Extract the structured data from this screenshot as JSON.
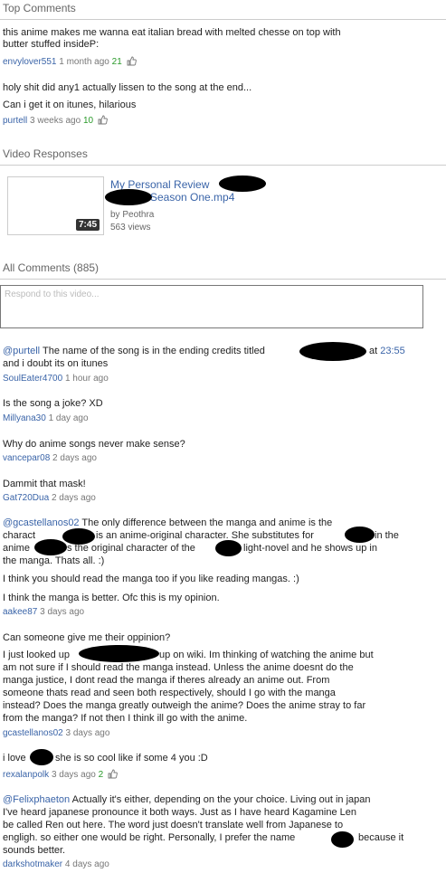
{
  "sections": {
    "top_comments": "Top Comments",
    "video_responses": "Video Responses",
    "all_comments": "All Comments (885)"
  },
  "top_comments": [
    {
      "line1": "this anime makes me wanna eat italian bread with melted chesse on top with",
      "line2": "butter stuffed insideP:",
      "user": "envylover551",
      "time": "1 month ago",
      "likes": "21"
    },
    {
      "line1": "holy shit did any1 actually lissen to the song at the end...",
      "line2": "Can i get it on itunes, hilarious",
      "user": "purtell",
      "time": "3 weeks ago",
      "likes": "10"
    }
  ],
  "video_response": {
    "title_1": "My Personal Review",
    "title_2": "Season One.mp4",
    "by": "by Peothra",
    "views": "563 views",
    "duration": "7:45"
  },
  "respond_placeholder": "Respond to this video...",
  "comments": [
    {
      "mention": "@purtell",
      "t1": "The name of the song is in the ending credits titled",
      "t1b": "at",
      "timecode": "23:55",
      "t2": "and i doubt its on itunes",
      "user": "SoulEater4700",
      "time": "1 hour ago"
    },
    {
      "text": "Is the song a joke? XD",
      "user": "Millyana30",
      "time": "1 day ago"
    },
    {
      "text": "Why do anime songs never make sense?",
      "user": "vancepar08",
      "time": "2 days ago"
    },
    {
      "text": "Dammit that mask!",
      "user": "Gat720Dua",
      "time": "2 days ago"
    },
    {
      "mention": "@gcastellanos02",
      "l1": "The only difference between the manga and anime is the",
      "l2a": "charact",
      "l2b": "is an anime-original character. She substitutes for",
      "l2c": "in the",
      "l3a": "anime",
      "l3b": "s the original character of the",
      "l3c": "light-novel and he shows up in",
      "l4": "the manga. Thats all. :)",
      "l5": "I think you should read the manga too if you like reading mangas. :)",
      "l6": "I think the manga is better. Ofc this is my opinion.",
      "user": "aakee87",
      "time": "3 days ago"
    },
    {
      "q": "Can someone give me their oppinion?",
      "l1a": "I just looked up",
      "l1b": "up on wiki. Im thinking of watching the anime but",
      "l2": "am not sure if I should read the manga instead. Unless the anime doesnt do the",
      "l3": "manga justice, I dont read the manga if theres already an anime out. From",
      "l4": "someone thats read and seen both respectively, should I go with the manga",
      "l5": "instead? Does the manga greatly outweigh the anime? Does the anime stray to far",
      "l6": "from the manga? If not then I think ill go with the anime.",
      "user": "gcastellanos02",
      "time": "3 days ago"
    },
    {
      "t1": "i love",
      "t2": "she is so cool like if some 4 you :D",
      "user": "rexalanpolk",
      "time": "3 days ago",
      "likes": "2"
    },
    {
      "mention": "@Felixphaeton",
      "l1": "Actually it's either, depending on the your choice. Living out in japan",
      "l2": "I've heard japanese pronounce it both ways. Just as I have heard Kagamine Len",
      "l3": "be called Ren out here. The word just doesn't translate well from Japanese to",
      "l4": "engligh. so either one would be right. Personally, I prefer the name",
      "l4b": "because it",
      "l5": "sounds better.",
      "user": "darkshotmaker",
      "time": "4 days ago"
    }
  ]
}
